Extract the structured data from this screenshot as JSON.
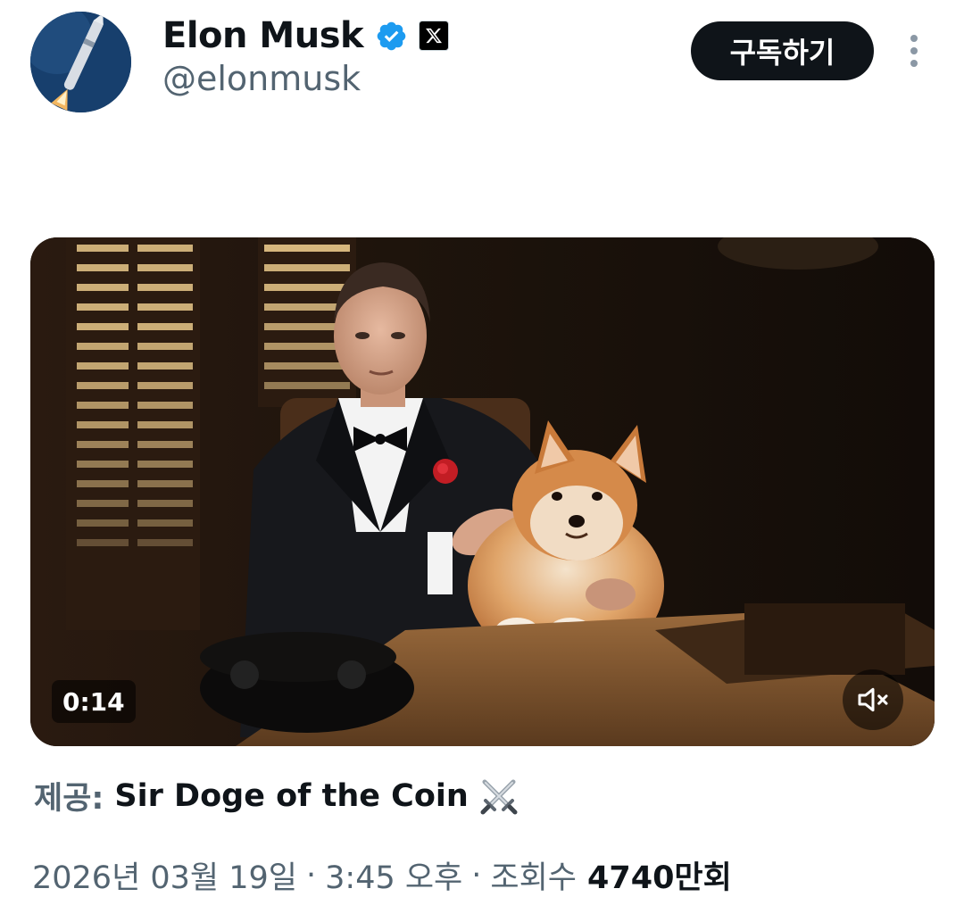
{
  "author": {
    "display_name": "Elon Musk",
    "handle": "@elonmusk",
    "verified_icon": "verified-badge-icon",
    "affiliate_icon": "x-logo-icon"
  },
  "header": {
    "subscribe_label": "구독하기",
    "more_icon": "more-vertical-icon"
  },
  "media": {
    "duration": "0:14",
    "mute_icon": "volume-muted-icon"
  },
  "attribution": {
    "prefix": "제공:",
    "source": "Sir Doge of the Coin",
    "emoji_icon": "crossed-swords-icon"
  },
  "meta": {
    "date": "2026년 03월 19일",
    "separator": "·",
    "time": "3:45 오후",
    "views_label": "조회수",
    "views_count": "4740만회"
  },
  "colors": {
    "text_primary": "#0f1419",
    "text_secondary": "#536471",
    "verified_blue": "#1d9bf0",
    "button_dark": "#0f1419"
  }
}
